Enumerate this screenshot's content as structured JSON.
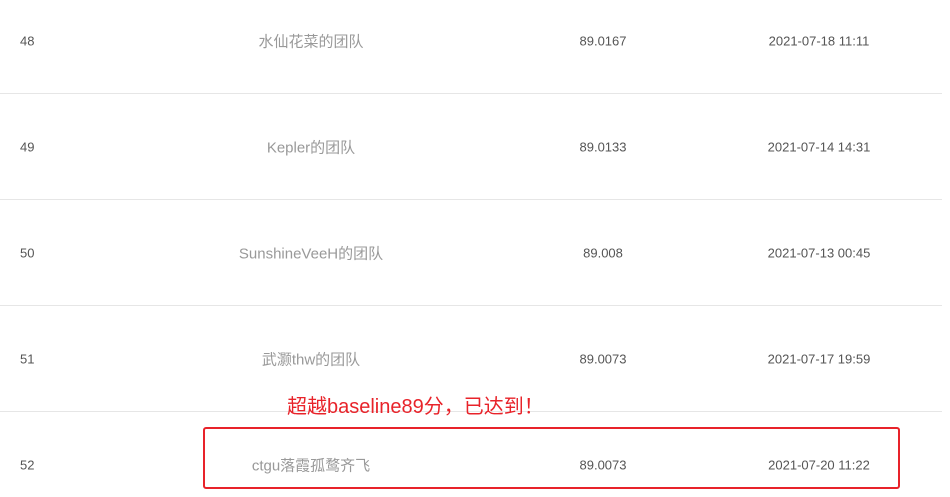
{
  "rows": [
    {
      "rank": "48",
      "team": "水仙花菜的团队",
      "score": "89.0167",
      "time": "2021-07-18 11:11"
    },
    {
      "rank": "49",
      "team": "Kepler的团队",
      "score": "89.0133",
      "time": "2021-07-14 14:31"
    },
    {
      "rank": "50",
      "team": "SunshineVeeH的团队",
      "score": "89.008",
      "time": "2021-07-13 00:45"
    },
    {
      "rank": "51",
      "team": "武灏thw的团队",
      "score": "89.0073",
      "time": "2021-07-17 19:59"
    },
    {
      "rank": "52",
      "team": "ctgu落霞孤鹜齐飞",
      "score": "89.0073",
      "time": "2021-07-20 11:22"
    }
  ],
  "annotation": {
    "text": "超越baseline89分，已达到！",
    "color": "#e8232a"
  },
  "colors": {
    "team_text": "#999999",
    "value_text": "#555555",
    "row_divider": "#e6e6e6"
  }
}
